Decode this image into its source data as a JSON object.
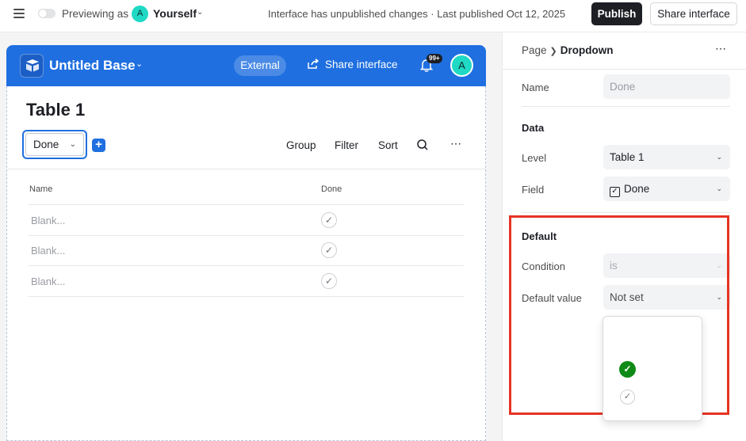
{
  "topbar": {
    "preview_label": "Previewing as",
    "user_initial": "A",
    "user_name": "Yourself",
    "status": "Interface has unpublished changes · Last published Oct 12, 2025",
    "publish_label": "Publish",
    "share_label": "Share interface"
  },
  "base": {
    "name": "Untitled Base",
    "external_label": "External",
    "share_interface_label": "Share interface",
    "notification_badge": "99+",
    "avatar_initial": "A",
    "header_color": "#1f6fe0"
  },
  "table": {
    "title": "Table 1",
    "dropdown_value": "Done",
    "toolbar": {
      "group": "Group",
      "filter": "Filter",
      "sort": "Sort"
    },
    "columns": [
      "Name",
      "Done"
    ],
    "rows": [
      {
        "name": "Blank...",
        "done_icon": "check-icon"
      },
      {
        "name": "Blank...",
        "done_icon": "check-icon"
      },
      {
        "name": "Blank...",
        "done_icon": "check-icon"
      }
    ]
  },
  "panel": {
    "breadcrumb_root": "Page",
    "breadcrumb_current": "Dropdown",
    "name_label": "Name",
    "name_placeholder": "Done",
    "data_section": "Data",
    "level_label": "Level",
    "level_value": "Table 1",
    "field_label": "Field",
    "field_value": "Done",
    "default_section": "Default",
    "condition_label": "Condition",
    "condition_value": "is",
    "default_value_label": "Default value",
    "default_value_value": "Not set"
  },
  "popup_options": [
    {
      "icon": "checked-green-icon",
      "color": "#0f8a17"
    },
    {
      "icon": "unchecked-gray-icon",
      "color": "#cfd0d4"
    }
  ],
  "highlight_color": "#e63323"
}
